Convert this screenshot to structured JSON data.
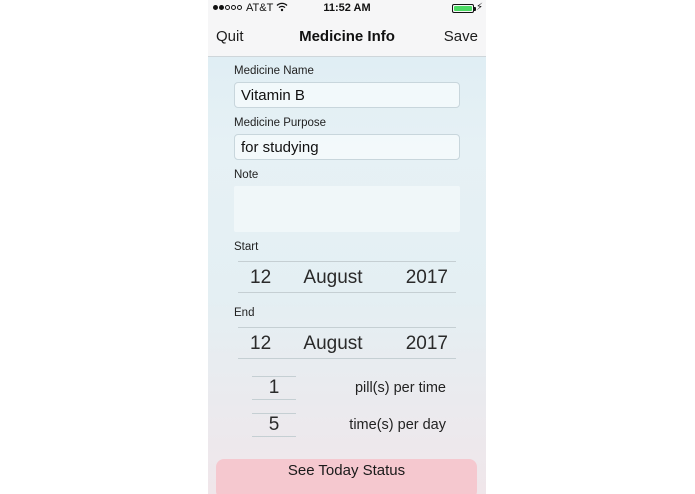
{
  "status_bar": {
    "carrier": "AT&T",
    "time": "11:52 AM",
    "signal_bars": 2,
    "battery_level": 1.0,
    "battery_color": "#4cd964"
  },
  "nav": {
    "left_label": "Quit",
    "title": "Medicine Info",
    "right_label": "Save"
  },
  "form": {
    "name_label": "Medicine Name",
    "name_value": "Vitamin B",
    "purpose_label": "Medicine Purpose",
    "purpose_value": "for studying",
    "note_label": "Note",
    "note_value": ""
  },
  "start": {
    "label": "Start",
    "day": "12",
    "month": "August",
    "year": "2017"
  },
  "end": {
    "label": "End",
    "day": "12",
    "month": "August",
    "year": "2017"
  },
  "dosage": {
    "pills_value": "1",
    "pills_unit": "pill(s) per time",
    "times_value": "5",
    "times_unit": "time(s) per day"
  },
  "actions": {
    "status_button": "See Today Status",
    "status_button_color": "#f5c8cf"
  },
  "icons": {
    "wifi": "wifi-icon",
    "battery": "battery-icon",
    "charging": "charging-bolt-icon",
    "signal": "signal-dots-icon"
  }
}
